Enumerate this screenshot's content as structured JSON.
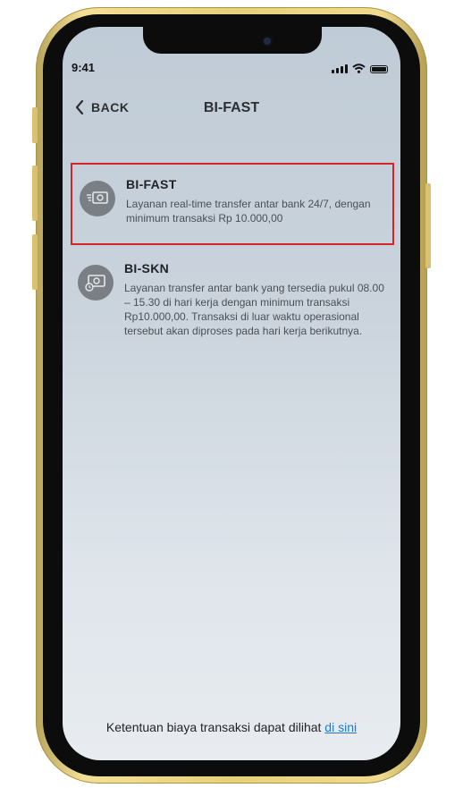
{
  "status_bar": {
    "time": "9:41"
  },
  "header": {
    "back_label": "BACK",
    "title": "BI-FAST"
  },
  "options": [
    {
      "icon": "transfer-fast-icon",
      "title": "BI-FAST",
      "description": "Layanan real-time transfer antar bank 24/7,  dengan minimum transaksi Rp 10.000,00",
      "selected": true
    },
    {
      "icon": "cash-transfer-icon",
      "title": "BI-SKN",
      "description": "Layanan transfer antar bank yang tersedia pukul 08.00 – 15.30 di hari kerja dengan minimum transaksi Rp10.000,00. Transaksi di luar waktu operasional tersebut akan diproses pada hari kerja berikutnya.",
      "selected": false
    }
  ],
  "footer": {
    "text": "Ketentuan biaya transaksi dapat dilihat ",
    "link_label": "di sini"
  },
  "colors": {
    "selection_border": "#d7222a",
    "link": "#1a7bd4",
    "frame_gold": "#e8d07a"
  }
}
